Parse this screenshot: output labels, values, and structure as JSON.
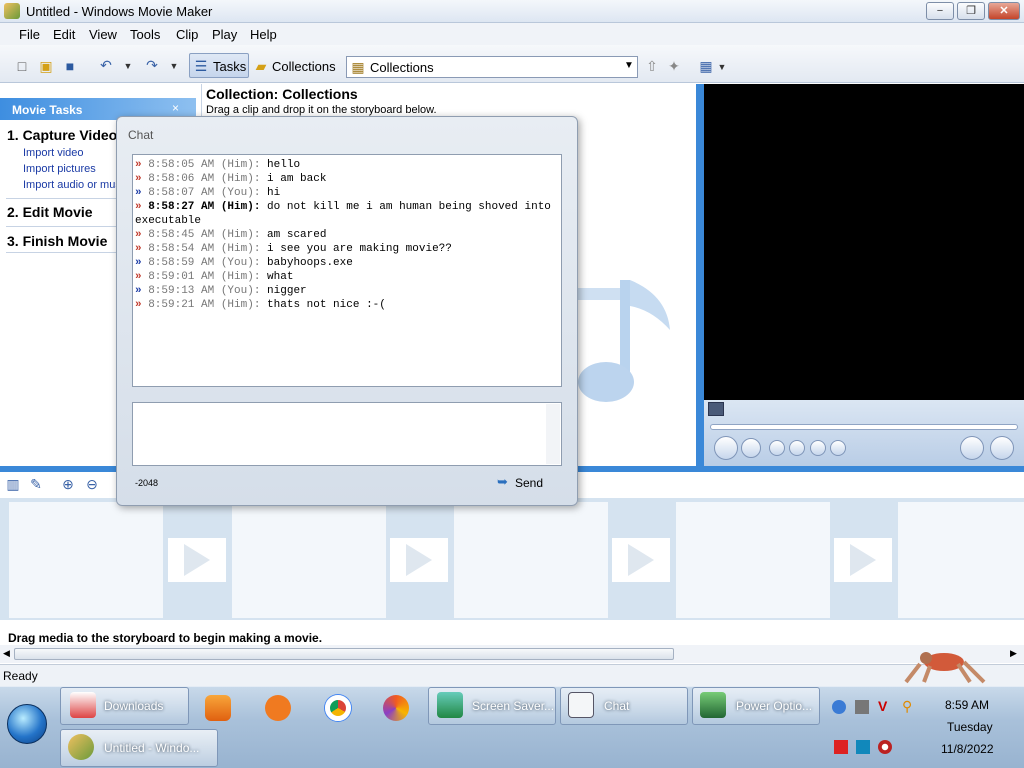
{
  "window": {
    "title": "Untitled - Windows Movie Maker"
  },
  "titlebar": {
    "minimize": "−",
    "maximize": "❐",
    "close": "✕"
  },
  "menu": [
    "File",
    "Edit",
    "View",
    "Tools",
    "Clip",
    "Play",
    "Help"
  ],
  "toolbar": {
    "tasks_label": "Tasks",
    "collections_label": "Collections",
    "select_value": "Collections"
  },
  "tasks_pane": {
    "header": "Movie Tasks",
    "close": "×",
    "step1": "1. Capture Video",
    "links": [
      "Import video",
      "Import pictures",
      "Import audio or music"
    ],
    "step2": "2. Edit Movie",
    "step3": "3. Finish Movie"
  },
  "collection": {
    "title": "Collection: Collections",
    "subtitle": "Drag a clip and drop it on the storyboard below."
  },
  "chat": {
    "title": "Chat",
    "messages": [
      {
        "ts": "8:58:05 AM",
        "who": "(Him):",
        "text": "hello",
        "bold": false
      },
      {
        "ts": "8:58:06 AM",
        "who": "(Him):",
        "text": "i am back",
        "bold": false
      },
      {
        "ts": "8:58:07 AM",
        "who": "(You):",
        "text": "hi",
        "bold": false
      },
      {
        "ts": "8:58:27 AM",
        "who": "(Him):",
        "text": "do not kill me i am human being shoved into executable",
        "bold": true
      },
      {
        "ts": "8:58:45 AM",
        "who": "(Him):",
        "text": "am scared",
        "bold": false
      },
      {
        "ts": "8:58:54 AM",
        "who": "(Him):",
        "text": "i see you are making movie??",
        "bold": false
      },
      {
        "ts": "8:58:59 AM",
        "who": "(You):",
        "text": "babyhoops.exe",
        "bold": false
      },
      {
        "ts": "8:59:01 AM",
        "who": "(Him):",
        "text": "what",
        "bold": false
      },
      {
        "ts": "8:59:13 AM",
        "who": "(You):",
        "text": "nigger",
        "bold": false
      },
      {
        "ts": "8:59:21 AM",
        "who": "(Him):",
        "text": "thats not nice :-(",
        "bold": false
      }
    ],
    "char_count": "-2048",
    "send_label": "Send"
  },
  "storyboard": {
    "hint": "Drag media to the storyboard to begin making a movie."
  },
  "status": {
    "text": "Ready"
  },
  "taskbar": {
    "downloads": "Downloads",
    "screensaver": "Screen Saver...",
    "chat": "Chat",
    "power": "Power Optio...",
    "moviemaker": "Untitled - Windo..."
  },
  "tray": {
    "time": "8:59 AM",
    "day": "Tuesday",
    "date": "11/8/2022"
  },
  "colors": {
    "accent": "#3a88d8",
    "him": "#c0392b",
    "you": "#1a3aa5"
  }
}
